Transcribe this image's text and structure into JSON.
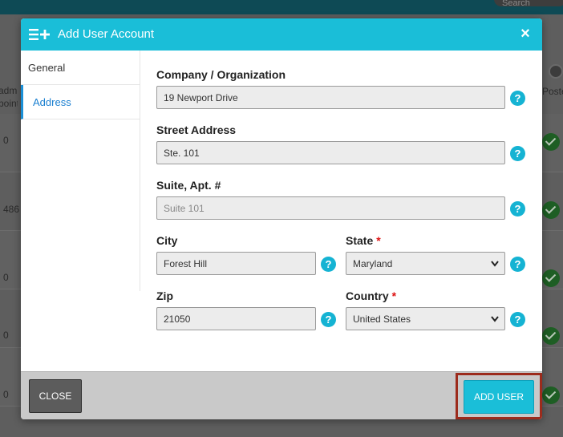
{
  "background": {
    "search_placeholder": "Search",
    "header_left": "admi points",
    "header_right": "Poste",
    "row_values": [
      "0",
      "486",
      "0",
      "0",
      "0"
    ]
  },
  "modal": {
    "title": "Add User Account",
    "title_icon": "list-add-icon",
    "close_icon": "close-icon",
    "sidebar": {
      "items": [
        {
          "label": "General",
          "active": false
        },
        {
          "label": "Address",
          "active": true
        }
      ]
    },
    "form": {
      "company": {
        "label": "Company / Organization",
        "value": "19 Newport Drive"
      },
      "street": {
        "label": "Street Address",
        "value": "Ste. 101"
      },
      "suite": {
        "label": "Suite, Apt. #",
        "placeholder": "Suite 101"
      },
      "city": {
        "label": "City",
        "value": "Forest Hill"
      },
      "state": {
        "label": "State",
        "required_mark": "*",
        "value": "Maryland"
      },
      "zip": {
        "label": "Zip",
        "value": "21050"
      },
      "country": {
        "label": "Country",
        "required_mark": "*",
        "value": "United States"
      },
      "help_glyph": "?"
    },
    "footer": {
      "close_label": "CLOSE",
      "add_label": "ADD USER"
    }
  },
  "colors": {
    "accent": "#1abed8",
    "link": "#1a7fd0",
    "required": "#dd1111",
    "highlight_border": "#9c2b1c",
    "close_button": "#5c5c5c"
  }
}
